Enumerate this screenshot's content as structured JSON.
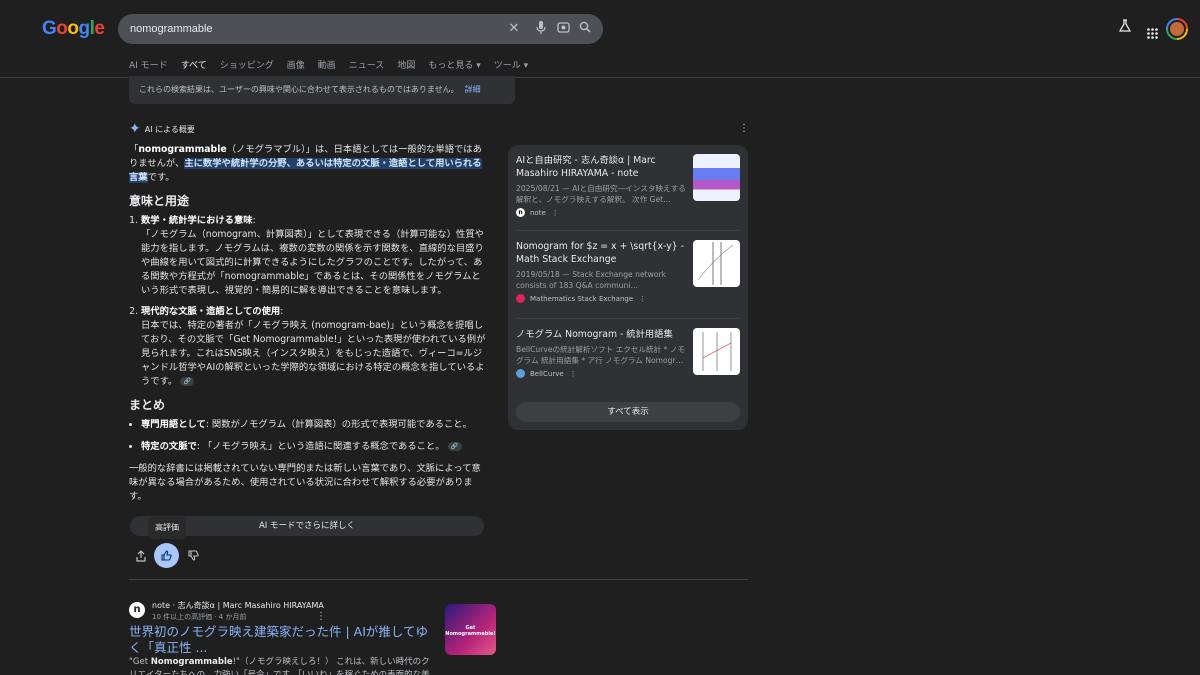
{
  "header": {
    "logo": "Google",
    "search_query": "nomogrammable",
    "clear_icon": "close-icon",
    "mic_icon": "mic-icon",
    "lens_icon": "lens-icon",
    "search_icon": "search-icon",
    "labs_icon": "flask-icon",
    "apps_icon": "apps-grid-icon"
  },
  "tabs": [
    {
      "label": "AI モード",
      "active": false
    },
    {
      "label": "すべて",
      "active": true
    },
    {
      "label": "ショッピング",
      "active": false
    },
    {
      "label": "画像",
      "active": false
    },
    {
      "label": "動画",
      "active": false
    },
    {
      "label": "ニュース",
      "active": false
    },
    {
      "label": "地図",
      "active": false
    },
    {
      "label": "もっと見る ▾",
      "active": false
    },
    {
      "label": "ツール ▾",
      "active": false
    }
  ],
  "notice": {
    "text": "これらの検索結果は、ユーザーの興味や関心に合わせて表示されるものではありません。",
    "link": "詳細"
  },
  "ai_overview": {
    "label": "AI による概要",
    "intro_pre": "「",
    "intro_term": "nomogrammable",
    "intro_mid": "（ノモグラマブル）」は、日本語としては一般的な単語ではありませんが、",
    "intro_highlight": "主に数学や統計学の分野、あるいは特定の文脈・造語として用いられる言葉",
    "intro_post": "です。",
    "section1_title": "意味と用途",
    "item1_title": "数学・統計学における意味",
    "item1_text": "「ノモグラム（nomogram、計算図表）」として表現できる（計算可能な）性質や能力を指します。ノモグラムは、複数の変数の関係を示す関数を、直線的な目盛りや曲線を用いて図式的に計算できるようにしたグラフのことです。したがって、ある関数や方程式が「nomogrammable」であるとは、その関係性をノモグラムという形式で表現し、視覚的・簡易的に解を導出できることを意味します。",
    "item2_title": "現代的な文脈・造語としての使用",
    "item2_text": "日本では、特定の著者が「ノモグラ映え (nomogram-bae)」という概念を提唱しており、その文脈で「Get Nomogrammable!」といった表現が使われている例が見られます。これはSNS映え（インスタ映え）をもじった造語で、ヴィーコ=ルジャンドル哲学やAIの解釈といった学際的な領域における特定の概念を指しているようです。",
    "section2_title": "まとめ",
    "bullet1_title": "専門用語として",
    "bullet1_text": ": 関数がノモグラム（計算図表）の形式で表現可能であること。",
    "bullet2_title": "特定の文脈で",
    "bullet2_text": ": 「ノモグラ映え」という造語に関連する概念であること。",
    "closing": "一般的な辞書には掲載されていない専門的または新しい言葉であり、文脈によって意味が異なる場合があるため、使用されている状況に合わせて解釈する必要があります。",
    "more_button": "AI モードでさらに詳しく",
    "tooltip": "高評価"
  },
  "sources": [
    {
      "title": "AIと自由研究 - 志ん奇談α | Marc Masahiro HIRAYAMA - note",
      "snippet": "2025/08/21 — AIと自由研究―インスタ映えする解釈と、ノモグラ映えする解釈。 次作 Get…",
      "site": "note",
      "fav_color": "#ffffff"
    },
    {
      "title": "Nomogram for $z = x + \\sqrt{x-y} - Math Stack Exchange",
      "snippet": "2019/05/18 — Stack Exchange network consists of 183 Q&A communi…",
      "site": "Mathematics Stack Exchange",
      "fav_color": "#e0245e"
    },
    {
      "title": "ノモグラム Nomogram - 統計用語集",
      "snippet": "BellCurveの統計解析ソフト エクセル統計 * ノモグラム 統計用語集 * ア行 ノモグラム Nomogr…",
      "site": "BellCurve",
      "fav_color": "#5aa0d8"
    }
  ],
  "show_all": "すべて表示",
  "organic": {
    "site": "note · 志ん奇談α | Marc Masahiro HIRAYAMA",
    "sub": "10 件以上の高評価 · 4 か月前",
    "title": "世界初のノモグラ映え建築家だった件 | AIが推してゆく「真正性 ...",
    "snippet_pre": "\"Get ",
    "snippet_term": "Nomogrammable",
    "snippet_post": "!\"（ノモグラ映えしろ！） これは、新しい時代のクリエイターたちへの、力強い「号令」です。「いいね」を稼ぐための表面的な美しさを追求",
    "thumb_text": "Get Nomogrammable!"
  }
}
